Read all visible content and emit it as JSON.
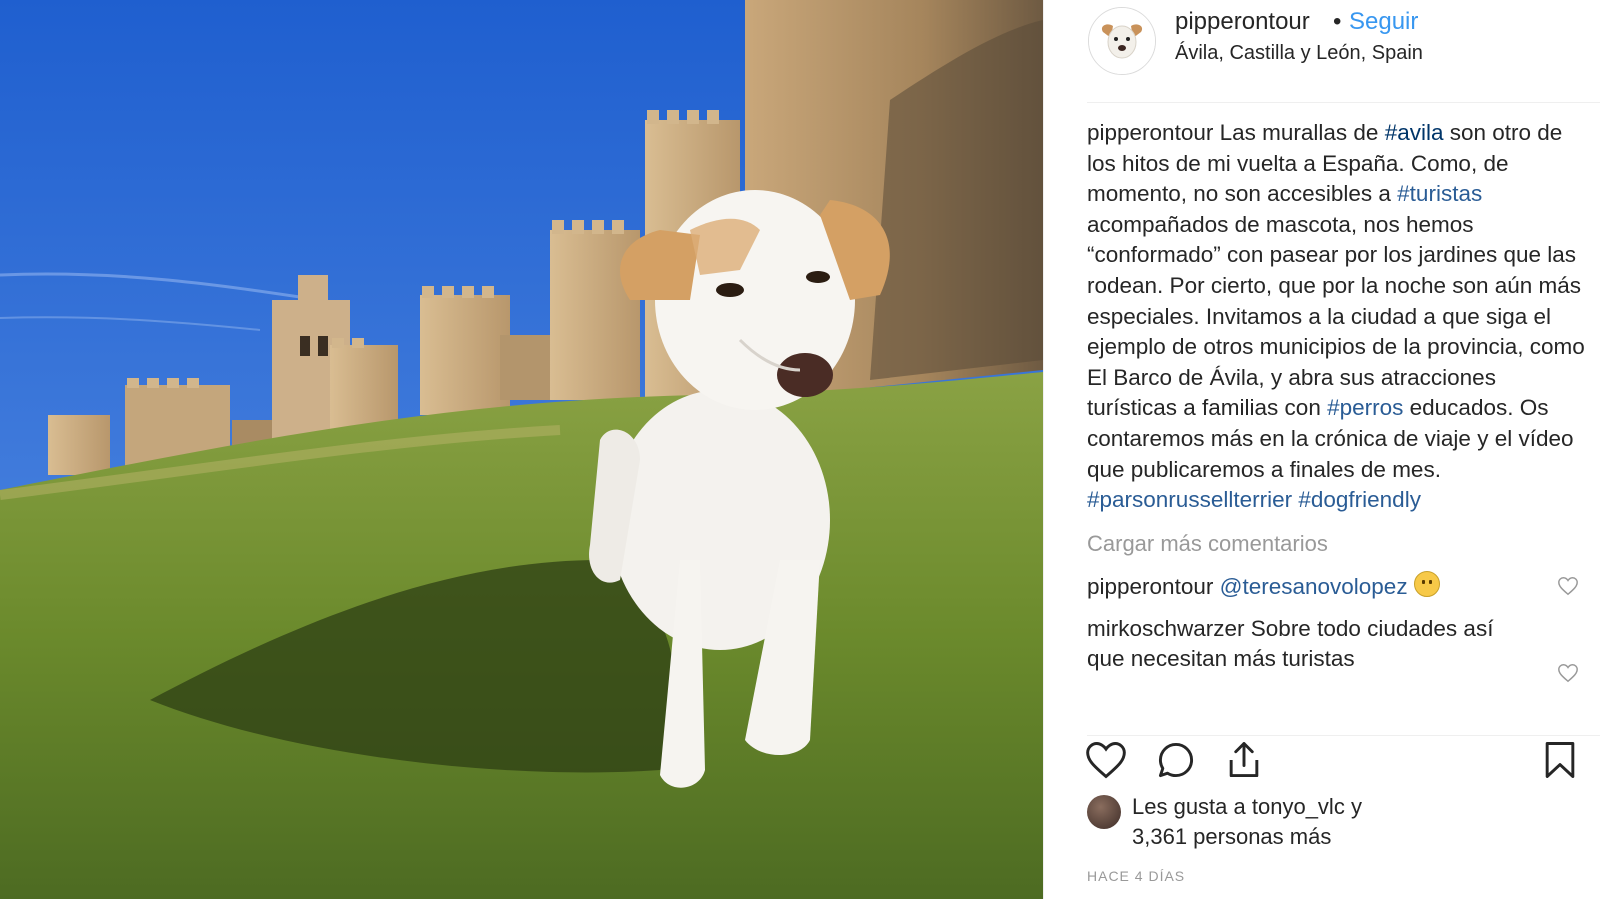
{
  "post": {
    "username": "pipperontour",
    "separator": "•",
    "follow_label": "Seguir",
    "location": "Ávila, Castilla y León, Spain"
  },
  "caption": {
    "username": "pipperontour",
    "parts": [
      {
        "text": " Las murallas de "
      },
      {
        "tag": "#avila"
      },
      {
        "text": " son otro de los hitos de mi vuelta a España. Como, de momento, no son accesibles a "
      },
      {
        "tag": "#turistas"
      },
      {
        "text": " acompañados de mascota, nos hemos “conformado” con pasear por los jardines que las rodean. Por cierto, que por la noche son aún más especiales. Invitamos a la ciudad a que siga el ejemplo de otros municipios de la provincia, como El Barco de Ávila, y abra sus atracciones turísticas a familias con "
      },
      {
        "tag": "#perros"
      },
      {
        "text": " educados. Os contaremos más en la crónica de viaje y el vídeo que publicaremos a finales de mes. "
      },
      {
        "tag": "#parsonrussellterrier"
      },
      {
        "text": " "
      },
      {
        "tag": "#dogfriendly"
      }
    ]
  },
  "load_more_label": "Cargar más comentarios",
  "comments": [
    {
      "username": "pipperontour",
      "mention": "@teresanovolopez",
      "text": " ",
      "emoji": "smiling-face"
    },
    {
      "username": "mirkoschwarzer",
      "mention": "",
      "text": " Sobre todo ciudades así que necesitan más turistas"
    }
  ],
  "actions": {
    "like": "heart-icon",
    "comment": "comment-bubble-icon",
    "share": "share-icon",
    "save": "bookmark-icon"
  },
  "likes": {
    "prefix": "Les gusta a ",
    "user": "tonyo_vlc",
    "suffix": " y",
    "others": "3,361 personas más"
  },
  "timestamp": "HACE 4 DÍAS",
  "colors": {
    "link_blue": "#3897f0",
    "hashtag": "#003569",
    "muted": "#999999",
    "text": "#262626",
    "sky": "#2f6fd6",
    "grass": "#6f8f2e"
  }
}
